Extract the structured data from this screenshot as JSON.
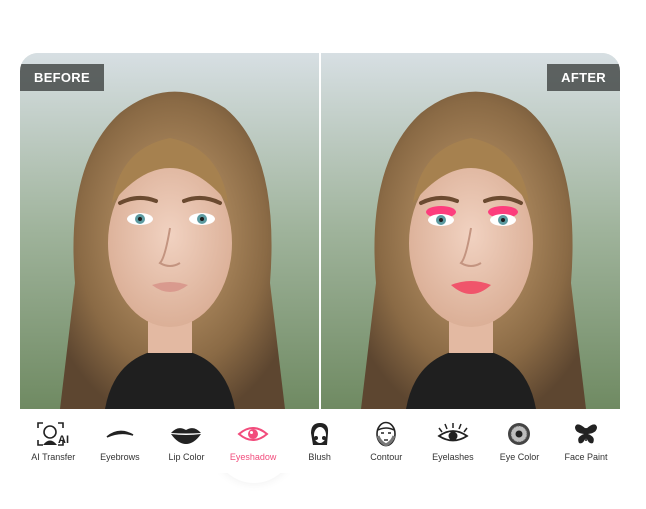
{
  "comparison": {
    "before_label": "BEFORE",
    "after_label": "AFTER"
  },
  "toolbar": {
    "active": "Eyeshadow",
    "accent_color": "#f24c7c",
    "items": [
      {
        "label": "AI Transfer",
        "icon": "ai-transfer-icon"
      },
      {
        "label": "Eyebrows",
        "icon": "eyebrow-icon"
      },
      {
        "label": "Lip Color",
        "icon": "lips-icon"
      },
      {
        "label": "Eyeshadow",
        "icon": "eye-icon"
      },
      {
        "label": "Blush",
        "icon": "blush-face-icon"
      },
      {
        "label": "Contour",
        "icon": "contour-face-icon"
      },
      {
        "label": "Eyelashes",
        "icon": "eyelash-icon"
      },
      {
        "label": "Eye Color",
        "icon": "iris-icon"
      },
      {
        "label": "Face Paint",
        "icon": "butterfly-icon"
      }
    ]
  }
}
